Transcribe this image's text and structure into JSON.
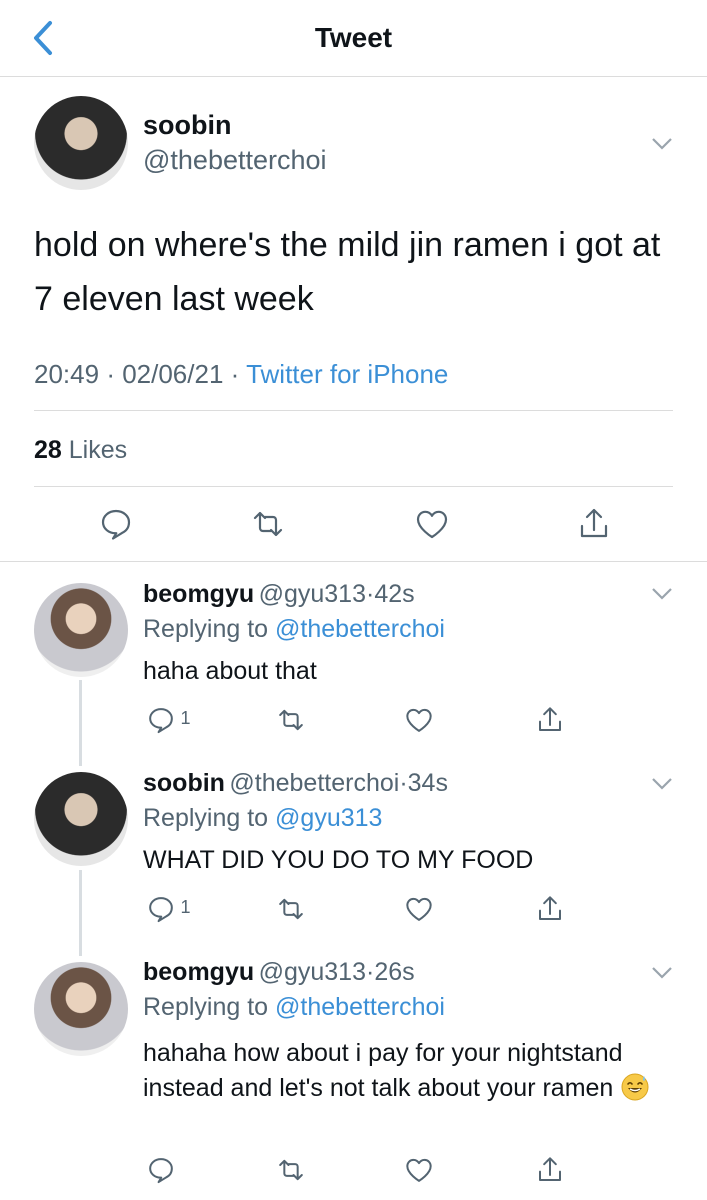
{
  "header": {
    "title": "Tweet"
  },
  "main_tweet": {
    "display_name": "soobin",
    "handle": "@thebetterchoi",
    "text": "hold on where's the mild jin ramen i got at 7 eleven last week",
    "time": "20:49",
    "date": "02/06/21",
    "source": "Twitter for iPhone",
    "likes_count": "28",
    "likes_label": "Likes"
  },
  "replies": [
    {
      "display_name": "beomgyu",
      "handle": "@gyu313",
      "age": "42s",
      "replying_prefix": "Replying to",
      "replying_to": "@thebetterchoi",
      "text": "haha about that",
      "reply_count": "1"
    },
    {
      "display_name": "soobin",
      "handle": "@thebetterchoi",
      "age": "34s",
      "replying_prefix": "Replying to",
      "replying_to": "@gyu313",
      "text": "WHAT DID YOU DO TO MY FOOD",
      "reply_count": "1"
    },
    {
      "display_name": "beomgyu",
      "handle": "@gyu313",
      "age": "26s",
      "replying_prefix": "Replying to",
      "replying_to": "@thebetterchoi",
      "text": "hahaha how about i pay for your nightstand instead and let's not talk about your ramen"
    }
  ],
  "colors": {
    "link": "#3b8fd6",
    "muted": "#536471",
    "divider": "#dcdcdc"
  }
}
